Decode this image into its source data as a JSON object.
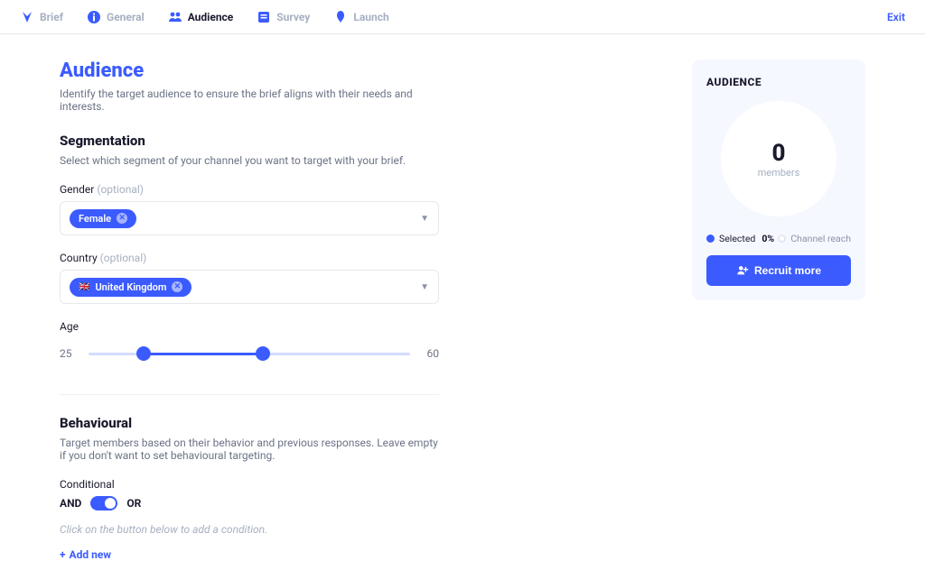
{
  "nav": {
    "tabs": [
      {
        "label": "Brief",
        "active": false
      },
      {
        "label": "General",
        "active": false
      },
      {
        "label": "Audience",
        "active": true
      },
      {
        "label": "Survey",
        "active": false
      },
      {
        "label": "Launch",
        "active": false
      }
    ],
    "exit": "Exit"
  },
  "header": {
    "title": "Audience",
    "subtitle": "Identify the target audience to ensure the brief aligns with their needs and interests."
  },
  "segmentation": {
    "heading": "Segmentation",
    "desc": "Select which segment of your channel you want to target with your brief.",
    "gender": {
      "label": "Gender",
      "optional": "(optional)",
      "chip_text": "Female"
    },
    "country": {
      "label": "Country",
      "optional": "(optional)",
      "chip_text": "United Kingdom",
      "flag": "🇬🇧"
    },
    "age": {
      "label": "Age",
      "min": "25",
      "max": "60",
      "range_min": 25,
      "range_max": 60,
      "low": 31,
      "high": 44
    }
  },
  "behavioural": {
    "heading": "Behavioural",
    "desc": "Target members based on their behavior and previous responses. Leave empty if you don't want to set behavioural targeting.",
    "conditional_label": "Conditional",
    "and": "AND",
    "or": "OR",
    "toggle_on": true,
    "hint": "Click on the button below to add a condition.",
    "add_new": "Add new"
  },
  "sidebar": {
    "heading": "AUDIENCE",
    "count": "0",
    "members": "members",
    "selected_label": "Selected",
    "selected_pct": "0%",
    "reach_label": "Channel reach",
    "recruit": "Recruit more"
  }
}
